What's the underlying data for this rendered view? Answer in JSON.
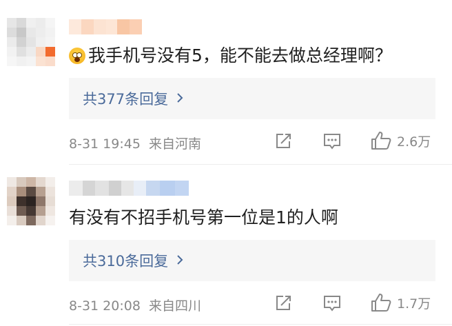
{
  "comments": [
    {
      "text": "我手机号没有5，能不能去做总经理啊？",
      "has_emoji": true,
      "emoji_icon": "shocked-face-emoji-icon",
      "reply_count_label": "共377条回复",
      "time": "8-31 19:45",
      "location": "来自河南",
      "like_count": "2.6万",
      "icons": [
        "share-icon",
        "comment-icon",
        "like-icon",
        "chevron-right-icon"
      ]
    },
    {
      "text": "有没有不招手机号第一位是1的人啊",
      "has_emoji": false,
      "reply_count_label": "共310条回复",
      "time": "8-31 20:08",
      "location": "来自四川",
      "like_count": "1.7万",
      "icons": [
        "share-icon",
        "comment-icon",
        "like-icon",
        "chevron-right-icon"
      ]
    }
  ],
  "colors": {
    "link": "#4a6a9a",
    "meta": "#888888",
    "reply_bg": "#f6f6f6"
  }
}
